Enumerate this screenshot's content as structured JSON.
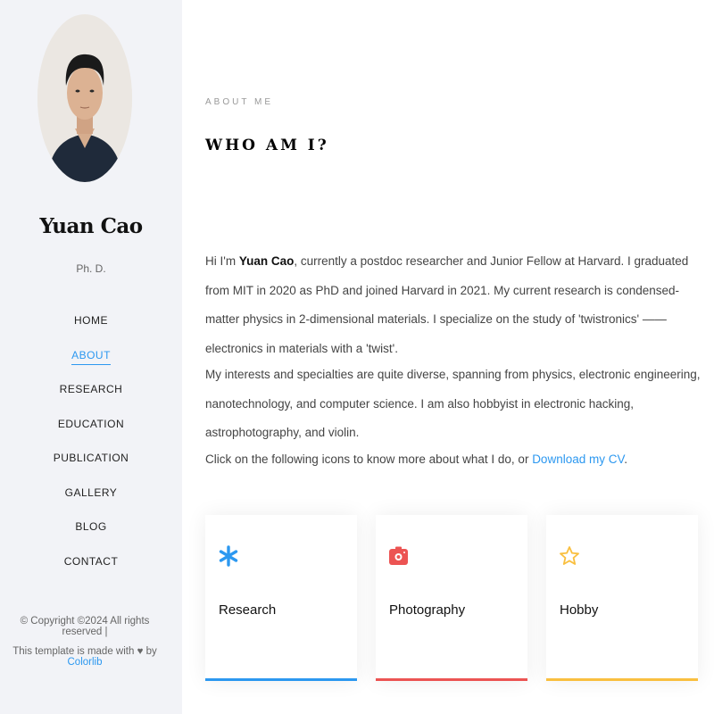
{
  "sidebar": {
    "name": "Yuan Cao",
    "degree": "Ph. D.",
    "nav": [
      {
        "label": "HOME",
        "active": false
      },
      {
        "label": "ABOUT",
        "active": true
      },
      {
        "label": "RESEARCH",
        "active": false
      },
      {
        "label": "EDUCATION",
        "active": false
      },
      {
        "label": "PUBLICATION",
        "active": false
      },
      {
        "label": "GALLERY",
        "active": false
      },
      {
        "label": "BLOG",
        "active": false
      },
      {
        "label": "CONTACT",
        "active": false
      }
    ],
    "copyright": "© Copyright ©2024 All rights reserved |",
    "made_prefix": "This template is made with",
    "made_by": "by",
    "made_link": "Colorlib"
  },
  "main": {
    "eyebrow": "ABOUT ME",
    "heading": "WHO AM I?",
    "p1_pre": "Hi I'm ",
    "p1_name": "Yuan Cao",
    "p1_post": ", currently a postdoc researcher and Junior Fellow at Harvard. I graduated from MIT in 2020 as PhD and joined Harvard in 2021. My current research is condensed-matter physics in 2-dimensional materials. I specialize on the study of 'twistronics' —— electronics in materials with a 'twist'.",
    "p2": "My interests and specialties are quite diverse, spanning from physics, electronic engineering, nanotechnology, and computer science. I am also hobbyist in electronic hacking, astrophotography, and violin.",
    "p3_pre": "Click on the following icons to know more about what I do, or ",
    "p3_link": "Download my CV",
    "p3_post": ".",
    "cards": [
      {
        "label": "Research",
        "icon": "asterisk-icon",
        "color": "#2c98f0"
      },
      {
        "label": "Photography",
        "icon": "camera-icon",
        "color": "#ec5453"
      },
      {
        "label": "Hobby",
        "icon": "star-icon",
        "color": "#f9bf3f"
      }
    ]
  },
  "colors": {
    "accent": "#2c98f0",
    "sidebar_bg": "#f2f3f7"
  }
}
